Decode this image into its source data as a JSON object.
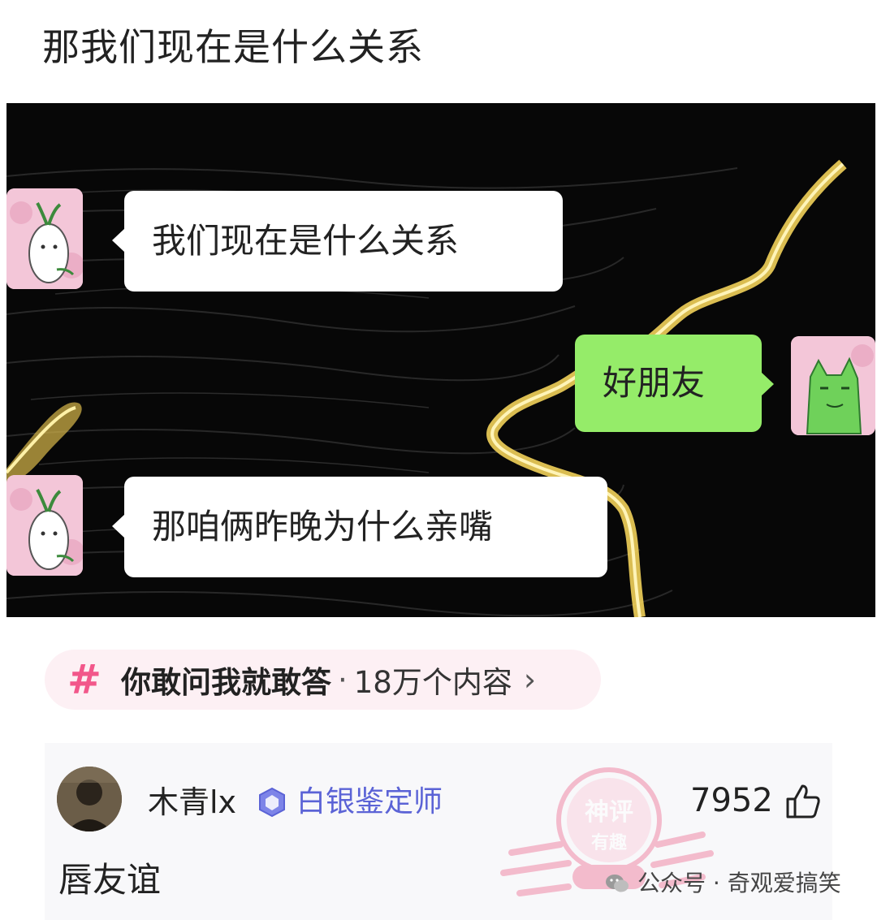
{
  "question": {
    "title": "那我们现在是什么关系"
  },
  "chat": {
    "messages": [
      {
        "side": "left",
        "text": "我们现在是什么关系"
      },
      {
        "side": "right",
        "text": "好朋友"
      },
      {
        "side": "left",
        "text": "那咱俩昨晚为什么亲嘴"
      }
    ]
  },
  "topic": {
    "hash": "#",
    "name": "你敢问我就敢答",
    "dot": "·",
    "count": "18万个内容",
    "arrow": "›"
  },
  "answer": {
    "username": "木青lx",
    "badge_label": "白银鉴定师",
    "likes": "7952",
    "text": "唇友谊",
    "stamp_lines": [
      "神评",
      "有趣"
    ]
  },
  "watermark": {
    "text": "公众号 · 奇观爱搞笑"
  },
  "colors": {
    "bubble_green": "#95ec69",
    "topic_pink": "#f2578a",
    "badge_blue": "#5b63d6"
  }
}
